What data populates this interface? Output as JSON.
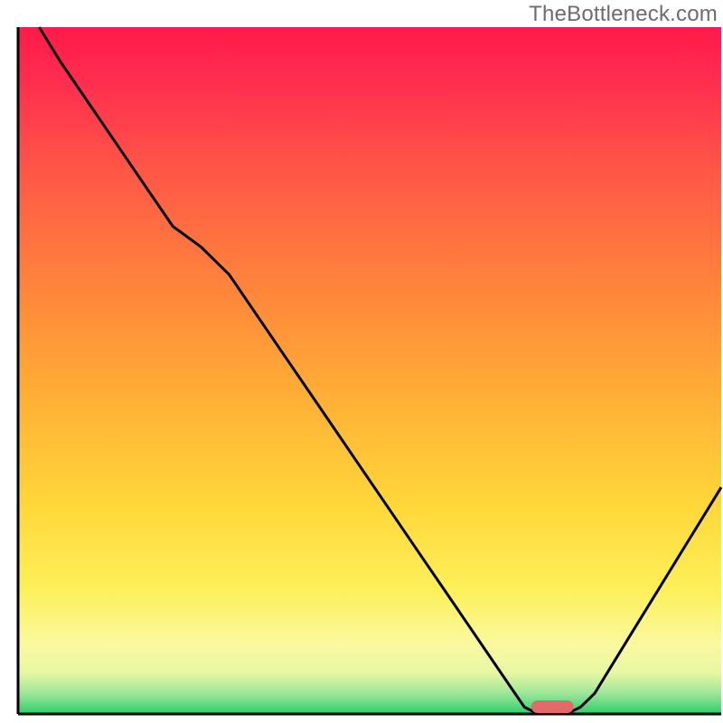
{
  "watermark": "TheBottleneck.com",
  "chart_data": {
    "type": "line",
    "title": "",
    "xlabel": "",
    "ylabel": "",
    "xlim": [
      0,
      100
    ],
    "ylim": [
      0,
      100
    ],
    "grid": false,
    "curve": {
      "name": "bottleneck-curve",
      "x": [
        3,
        6,
        10,
        14,
        18,
        22,
        26,
        30,
        34,
        38,
        42,
        46,
        50,
        54,
        58,
        62,
        66,
        70,
        72,
        74,
        76,
        78,
        80,
        82,
        85,
        88,
        91,
        94,
        97,
        100
      ],
      "values": [
        100,
        95,
        89,
        83,
        77,
        71,
        68,
        64,
        58,
        52,
        46,
        40,
        34,
        28,
        22,
        16,
        10,
        4,
        1,
        0,
        0,
        0,
        1,
        3,
        8,
        13,
        18,
        23,
        28,
        33
      ]
    },
    "optimal_marker": {
      "name": "optimal-range",
      "x_start": 73,
      "x_end": 79,
      "level": 0
    },
    "gradient_stops": [
      {
        "offset": 0,
        "color": "#ff1a4a"
      },
      {
        "offset": 0.08,
        "color": "#ff2e4f"
      },
      {
        "offset": 0.22,
        "color": "#ff5a46"
      },
      {
        "offset": 0.4,
        "color": "#ff8a3a"
      },
      {
        "offset": 0.55,
        "color": "#ffb236"
      },
      {
        "offset": 0.7,
        "color": "#ffd83a"
      },
      {
        "offset": 0.82,
        "color": "#fdf05a"
      },
      {
        "offset": 0.9,
        "color": "#faf9a0"
      },
      {
        "offset": 0.94,
        "color": "#e7f7a2"
      },
      {
        "offset": 0.97,
        "color": "#9ce69a"
      },
      {
        "offset": 1.0,
        "color": "#2ecf6a"
      }
    ],
    "marker_color": "#e36a6a",
    "curve_color": "#000000",
    "axis_color": "#000000"
  }
}
